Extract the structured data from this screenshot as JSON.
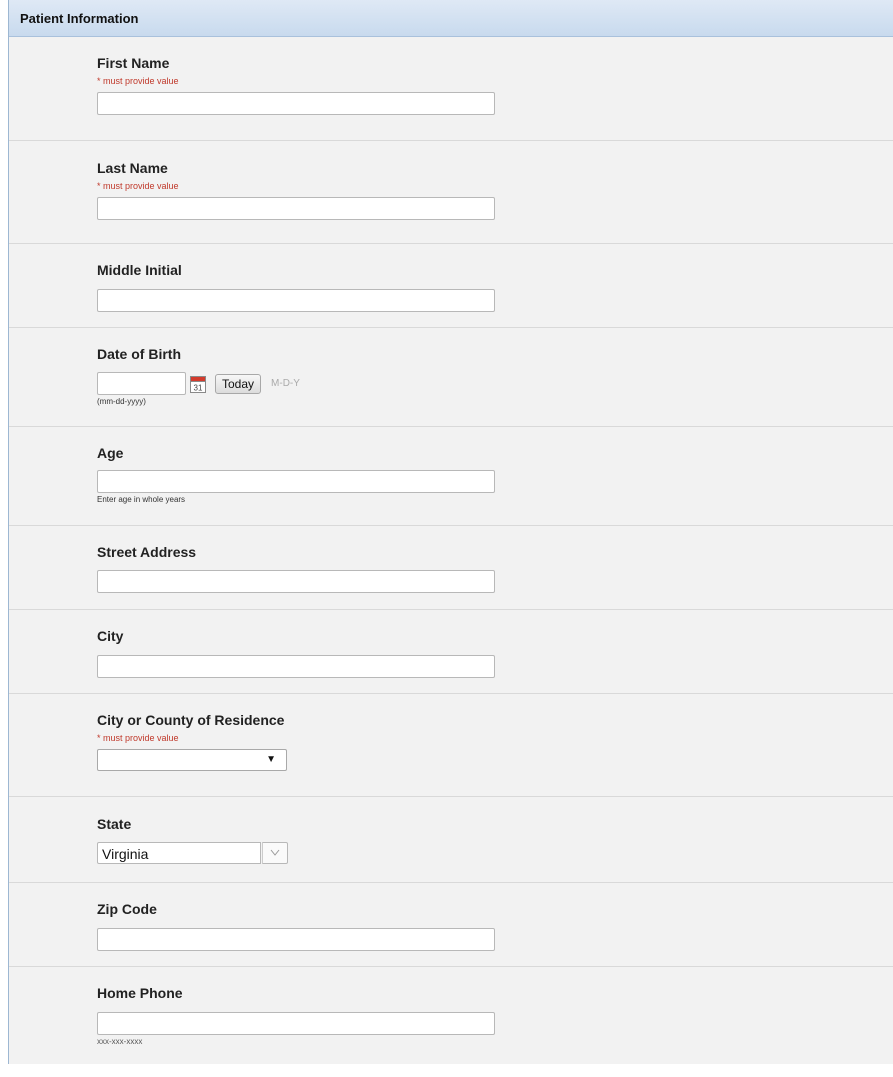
{
  "section": {
    "title": "Patient Information"
  },
  "required_note": "* must provide value",
  "fields": {
    "first_name": {
      "label": "First Name",
      "value": ""
    },
    "last_name": {
      "label": "Last Name",
      "value": ""
    },
    "middle_initial": {
      "label": "Middle Initial",
      "value": ""
    },
    "dob": {
      "label": "Date of Birth",
      "value": "",
      "hint": "(mm-dd-yyyy)",
      "today_label": "Today",
      "format_label": "M-D-Y"
    },
    "age": {
      "label": "Age",
      "value": "",
      "hint": "Enter age in whole years"
    },
    "street": {
      "label": "Street Address",
      "value": ""
    },
    "city": {
      "label": "City",
      "value": ""
    },
    "county": {
      "label": "City or County of Residence",
      "selected": ""
    },
    "state": {
      "label": "State",
      "selected": "Virginia"
    },
    "zip": {
      "label": "Zip Code",
      "value": ""
    },
    "home_phone": {
      "label": "Home Phone",
      "value": "",
      "hint": "xxx-xxx-xxxx"
    }
  },
  "colors": {
    "required": "#c0392b",
    "header_bg": "#c8daee",
    "panel_bg": "#f2f2f2"
  },
  "icons": {
    "calendar": "calendar-icon",
    "dropdown": "chevron-down-icon"
  }
}
